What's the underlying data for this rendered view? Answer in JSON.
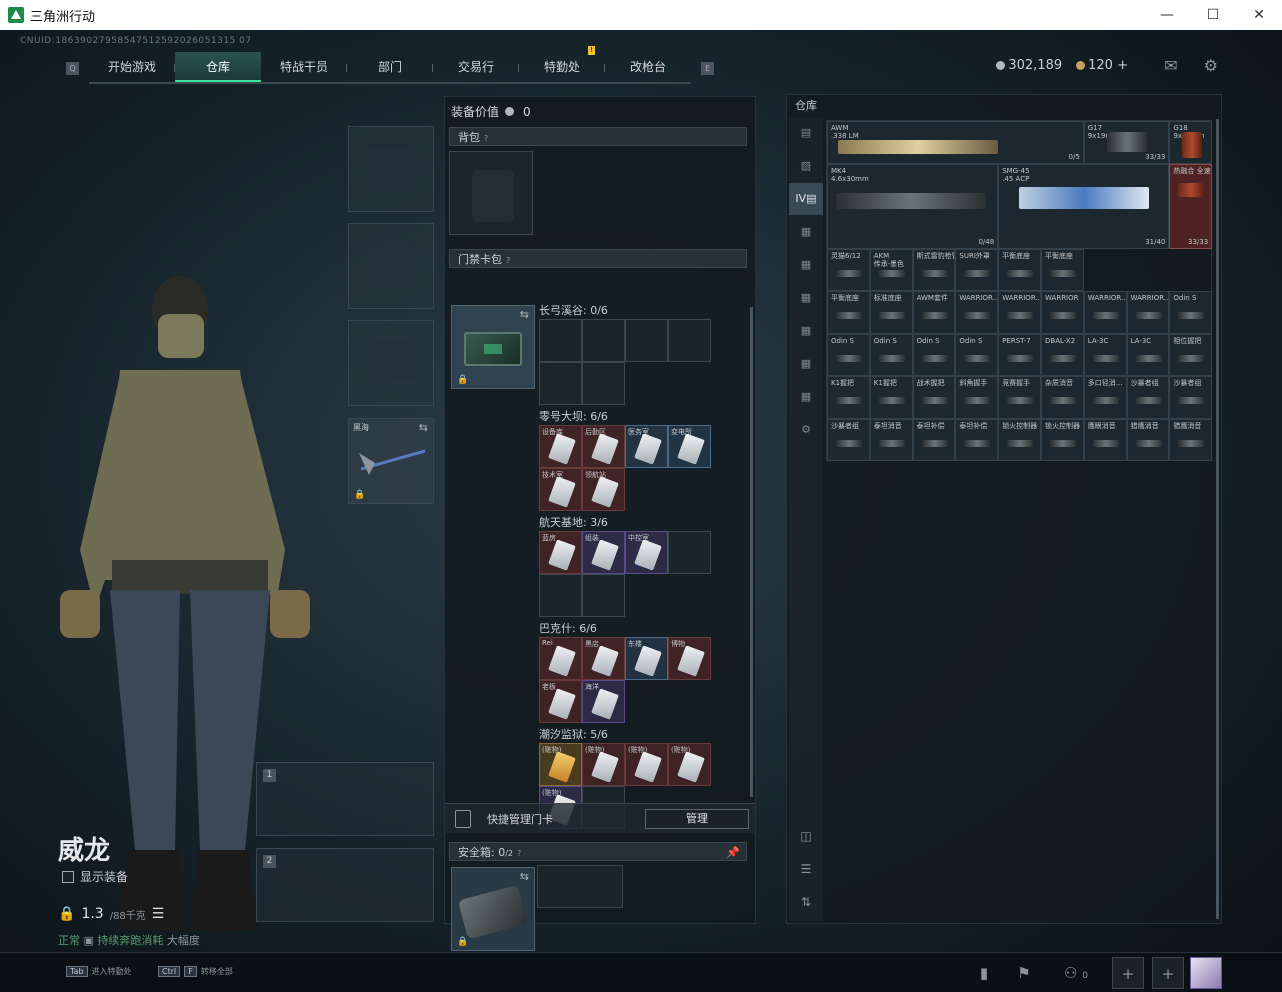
{
  "window": {
    "title": "三角洲行动"
  },
  "cnuid": "CNUID:18639027958547512592026051315 07",
  "nav": {
    "left_key": "Q",
    "right_key": "E",
    "tabs": [
      {
        "label": "开始游戏",
        "active": false
      },
      {
        "label": "仓库",
        "active": true
      },
      {
        "label": "特战干员",
        "active": false
      },
      {
        "label": "部门",
        "active": false
      },
      {
        "label": "交易行",
        "active": false
      },
      {
        "label": "特勤处",
        "active": false,
        "badge": "!"
      },
      {
        "label": "改枪台",
        "active": false
      }
    ]
  },
  "currency": {
    "silver": "302,189",
    "gold": "120",
    "gold_add": "+"
  },
  "character": {
    "name": "威龙",
    "show_equipment": "显示装备",
    "weight": "1.3",
    "weight_max": "/88千克",
    "weight_note_status": "正常",
    "weight_note_text": "持续奔跑消耗",
    "weight_note_suffix": "大幅度"
  },
  "melee": {
    "label": "黑海"
  },
  "weapon_slots": [
    {
      "num": "1"
    },
    {
      "num": "2"
    }
  ],
  "equip_value": {
    "label": "装备价值",
    "value": "0"
  },
  "backpack": {
    "label": "背包",
    "q": "?"
  },
  "keycard_bag": {
    "label": "门禁卡包",
    "q": "?"
  },
  "card_sections": [
    {
      "title": "长弓溪谷: 0/6",
      "cells": []
    },
    {
      "title": "零号大坝: 6/6",
      "cells": [
        {
          "label": "设备库",
          "color": "red"
        },
        {
          "label": "后勤区",
          "color": "red"
        },
        {
          "label": "医务室",
          "color": "blue"
        },
        {
          "label": "变电所",
          "color": "blue"
        },
        {
          "label": "技术室",
          "color": "red"
        },
        {
          "label": "领航站",
          "color": "red"
        }
      ]
    },
    {
      "title": "航天基地: 3/6",
      "cells": [
        {
          "label": "蓝房",
          "color": "red"
        },
        {
          "label": "组装",
          "color": "purple"
        },
        {
          "label": "中控室",
          "color": "purple"
        }
      ]
    },
    {
      "title": "巴克什: 6/6",
      "cells": [
        {
          "label": "Rei",
          "color": "red"
        },
        {
          "label": "黑店",
          "color": "red"
        },
        {
          "label": "东楼",
          "color": "blue"
        },
        {
          "label": "博物",
          "color": "red"
        },
        {
          "label": "老板",
          "color": "red"
        },
        {
          "label": "海洋",
          "color": "purple"
        }
      ]
    },
    {
      "title": "潮汐监狱: 5/6",
      "cells": [
        {
          "label": "(赃物)",
          "color": "gold"
        },
        {
          "label": "(赃物)",
          "color": "red"
        },
        {
          "label": "(赃物)",
          "color": "red"
        },
        {
          "label": "(赃物)",
          "color": "red"
        },
        {
          "label": "(赃物)",
          "color": "purple"
        }
      ]
    }
  ],
  "quick_manage": {
    "label": "快捷管理门卡",
    "button": "管理"
  },
  "safebox": {
    "label": "安全箱:",
    "value": "0",
    "max": "/2",
    "q": "?"
  },
  "warehouse": {
    "title": "仓库",
    "items": [
      {
        "name": "AWM",
        "sub": ".338 LM",
        "ammo": "0/5"
      },
      {
        "name": "G17",
        "sub": "9x19mm",
        "ammo": "33/33"
      },
      {
        "name": "G18",
        "sub": "9x19mm",
        "ammo": ""
      },
      {
        "name": "MK4",
        "sub": "4.6x30mm",
        "ammo": "0/48"
      },
      {
        "name": "SMG-45",
        "sub": ".45 ACP",
        "ammo": "31/40"
      },
      {
        "name": "热融合 全速",
        "sub": "",
        "ammo": "33/33"
      },
      {
        "name": "灵猫6/12"
      },
      {
        "name": "AKM\n传承·墨色"
      },
      {
        "name": "斯式雷豹枪管"
      },
      {
        "name": "SURI外罩"
      },
      {
        "name": "平衡底座"
      },
      {
        "name": "平衡底座"
      },
      {
        "name": "平衡底座"
      },
      {
        "name": "标准底座"
      },
      {
        "name": "AWM套件"
      },
      {
        "name": "WARRIOR.."
      },
      {
        "name": "WARRIOR.."
      },
      {
        "name": "WARRIOR"
      },
      {
        "name": "WARRIOR.."
      },
      {
        "name": "WARRIOR.."
      },
      {
        "name": "Odin S"
      },
      {
        "name": "Odin S"
      },
      {
        "name": "Odin S"
      },
      {
        "name": "Odin S"
      },
      {
        "name": "Odin S"
      },
      {
        "name": "PERST-7"
      },
      {
        "name": "DBAL-X2"
      },
      {
        "name": "LA-3C"
      },
      {
        "name": "LA-3C"
      },
      {
        "name": "相位握把"
      },
      {
        "name": "K1握把"
      },
      {
        "name": "K1握把"
      },
      {
        "name": "战术握把"
      },
      {
        "name": "斜角握手"
      },
      {
        "name": "竞赛握手"
      },
      {
        "name": "杂质消音"
      },
      {
        "name": "多口径消..."
      },
      {
        "name": "沙暴者组"
      },
      {
        "name": "沙暴者组"
      },
      {
        "name": "沙暴者组"
      },
      {
        "name": "泰坦消音"
      },
      {
        "name": "泰坦补偿"
      },
      {
        "name": "泰坦补偿"
      },
      {
        "name": "锁火控制器"
      },
      {
        "name": "锁火控制器"
      },
      {
        "name": "鹰眼消音"
      },
      {
        "name": "猎鹰消音"
      },
      {
        "name": "猎鹰消音"
      }
    ]
  },
  "bottom": {
    "hint1_key": "Tab",
    "hint1": "进入特勤处",
    "hint2_key1": "Ctrl",
    "hint2_key2": "F",
    "hint2": "转移全部",
    "friends": "0"
  }
}
